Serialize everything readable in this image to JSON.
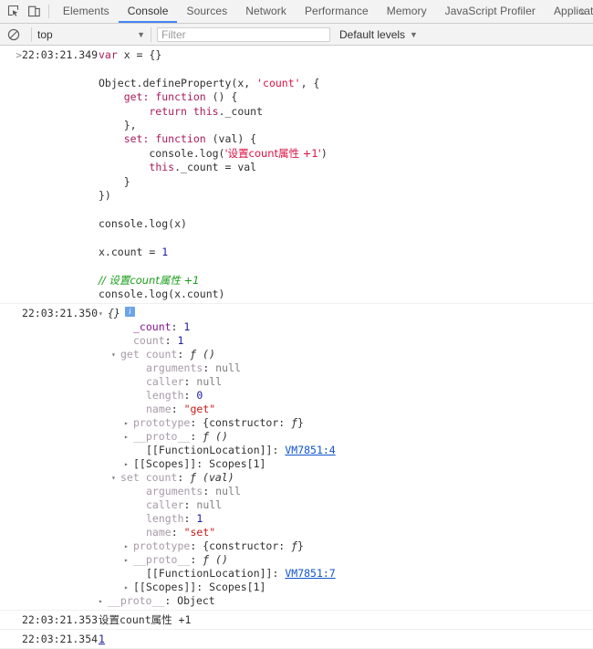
{
  "toolbar": {
    "inspect_icon": "inspect-element-icon",
    "device_icon": "device-toolbar-icon",
    "tabs": [
      {
        "label": "Elements",
        "selected": false
      },
      {
        "label": "Console",
        "selected": true
      },
      {
        "label": "Sources",
        "selected": false
      },
      {
        "label": "Network",
        "selected": false
      },
      {
        "label": "Performance",
        "selected": false
      },
      {
        "label": "Memory",
        "selected": false
      },
      {
        "label": "JavaScript Profiler",
        "selected": false
      },
      {
        "label": "Application",
        "selected": false
      }
    ],
    "more_label": "»"
  },
  "filterbar": {
    "clear_icon": "clear-console-icon",
    "context_value": "top",
    "context_caret": "▼",
    "filter_placeholder": "Filter",
    "filter_value": "",
    "levels_label": "Default levels",
    "levels_caret": "▼"
  },
  "console": {
    "messages": [
      {
        "prompt": ">",
        "timestamp": "22:03:21.349",
        "type": "input-code"
      },
      {
        "timestamp": "22:03:21.350",
        "type": "object-tree"
      },
      {
        "timestamp": "22:03:21.353",
        "type": "log",
        "text": "设置count属性 +1"
      },
      {
        "timestamp": "22:03:21.354",
        "type": "log-number",
        "text": "1"
      }
    ],
    "input_code_lines": [
      [
        {
          "t": "var ",
          "c": "kw"
        },
        {
          "t": "x = {}",
          "c": "plain"
        }
      ],
      [
        {
          "t": "",
          "c": "plain"
        }
      ],
      [
        {
          "t": "Object.defineProperty(x, ",
          "c": "plain"
        },
        {
          "t": "'count'",
          "c": "str"
        },
        {
          "t": ", {",
          "c": "plain"
        }
      ],
      [
        {
          "t": "    get: ",
          "c": "kw"
        },
        {
          "t": "function",
          "c": "kw"
        },
        {
          "t": " () {",
          "c": "plain"
        }
      ],
      [
        {
          "t": "        return ",
          "c": "kw"
        },
        {
          "t": "this",
          "c": "kw"
        },
        {
          "t": "._count",
          "c": "plain"
        }
      ],
      [
        {
          "t": "    },",
          "c": "plain"
        }
      ],
      [
        {
          "t": "    set: ",
          "c": "kw"
        },
        {
          "t": "function",
          "c": "kw"
        },
        {
          "t": " (val) {",
          "c": "plain"
        }
      ],
      [
        {
          "t": "        console.log(",
          "c": "plain"
        },
        {
          "t": "'设置count属性 +1'",
          "c": "str"
        },
        {
          "t": ")",
          "c": "plain"
        }
      ],
      [
        {
          "t": "        ",
          "c": "plain"
        },
        {
          "t": "this",
          "c": "kw"
        },
        {
          "t": "._count = val",
          "c": "plain"
        }
      ],
      [
        {
          "t": "    }",
          "c": "plain"
        }
      ],
      [
        {
          "t": "})",
          "c": "plain"
        }
      ],
      [
        {
          "t": "",
          "c": "plain"
        }
      ],
      [
        {
          "t": "console.log(x)",
          "c": "plain"
        }
      ],
      [
        {
          "t": "",
          "c": "plain"
        }
      ],
      [
        {
          "t": "x.count = ",
          "c": "plain"
        },
        {
          "t": "1",
          "c": "num"
        }
      ],
      [
        {
          "t": "",
          "c": "plain"
        }
      ],
      [
        {
          "t": "// 设置count属性 +1",
          "c": "cmt"
        }
      ],
      [
        {
          "t": "console.log(x.count)",
          "c": "plain"
        }
      ]
    ],
    "object_tree": {
      "root_arrow": "▾",
      "root_preview": "{}",
      "info_badge": "i",
      "rows": [
        {
          "indent": 1,
          "arrow": "none",
          "name": "_count",
          "name_style": "own",
          "sep": ": ",
          "value": "1",
          "value_style": "num"
        },
        {
          "indent": 1,
          "arrow": "none",
          "name": "count",
          "name_style": "dim",
          "sep": ": ",
          "value": "1",
          "value_style": "num"
        },
        {
          "indent": 0,
          "arrow": "open",
          "name": "get count",
          "name_style": "dim",
          "sep": ": ",
          "value": "ƒ ()",
          "value_style": "fn"
        },
        {
          "indent": 2,
          "arrow": "none",
          "name": "arguments",
          "name_style": "dim",
          "sep": ": ",
          "value": "null",
          "value_style": "null"
        },
        {
          "indent": 2,
          "arrow": "none",
          "name": "caller",
          "name_style": "dim",
          "sep": ": ",
          "value": "null",
          "value_style": "null"
        },
        {
          "indent": 2,
          "arrow": "none",
          "name": "length",
          "name_style": "dim",
          "sep": ": ",
          "value": "0",
          "value_style": "num"
        },
        {
          "indent": 2,
          "arrow": "none",
          "name": "name",
          "name_style": "dim",
          "sep": ": ",
          "value": "\"get\"",
          "value_style": "str"
        },
        {
          "indent": 1,
          "arrow": "closed",
          "name": "prototype",
          "name_style": "dim",
          "sep": ": ",
          "value": "{constructor: ƒ}",
          "value_style": "obj-fn"
        },
        {
          "indent": 1,
          "arrow": "closed",
          "name": "__proto__",
          "name_style": "dim",
          "sep": ": ",
          "value": "ƒ ()",
          "value_style": "fn"
        },
        {
          "indent": 2,
          "arrow": "none",
          "name": "[[FunctionLocation]]",
          "name_style": "dark",
          "sep": ": ",
          "value": "VM7851:4",
          "value_style": "link"
        },
        {
          "indent": 1,
          "arrow": "closed",
          "name": "[[Scopes]]",
          "name_style": "dark",
          "sep": ": ",
          "value": "Scopes[1]",
          "value_style": "obj"
        },
        {
          "indent": 0,
          "arrow": "open",
          "name": "set count",
          "name_style": "dim",
          "sep": ": ",
          "value": "ƒ (val)",
          "value_style": "fn"
        },
        {
          "indent": 2,
          "arrow": "none",
          "name": "arguments",
          "name_style": "dim",
          "sep": ": ",
          "value": "null",
          "value_style": "null"
        },
        {
          "indent": 2,
          "arrow": "none",
          "name": "caller",
          "name_style": "dim",
          "sep": ": ",
          "value": "null",
          "value_style": "null"
        },
        {
          "indent": 2,
          "arrow": "none",
          "name": "length",
          "name_style": "dim",
          "sep": ": ",
          "value": "1",
          "value_style": "num"
        },
        {
          "indent": 2,
          "arrow": "none",
          "name": "name",
          "name_style": "dim",
          "sep": ": ",
          "value": "\"set\"",
          "value_style": "str"
        },
        {
          "indent": 1,
          "arrow": "closed",
          "name": "prototype",
          "name_style": "dim",
          "sep": ": ",
          "value": "{constructor: ƒ}",
          "value_style": "obj-fn"
        },
        {
          "indent": 1,
          "arrow": "closed",
          "name": "__proto__",
          "name_style": "dim",
          "sep": ": ",
          "value": "ƒ ()",
          "value_style": "fn"
        },
        {
          "indent": 2,
          "arrow": "none",
          "name": "[[FunctionLocation]]",
          "name_style": "dark",
          "sep": ": ",
          "value": "VM7851:7",
          "value_style": "link"
        },
        {
          "indent": 1,
          "arrow": "closed",
          "name": "[[Scopes]]",
          "name_style": "dark",
          "sep": ": ",
          "value": "Scopes[1]",
          "value_style": "obj"
        },
        {
          "indent": -1,
          "arrow": "closed",
          "name": "__proto__",
          "name_style": "dim",
          "sep": ": ",
          "value": "Object",
          "value_style": "obj"
        }
      ]
    }
  }
}
